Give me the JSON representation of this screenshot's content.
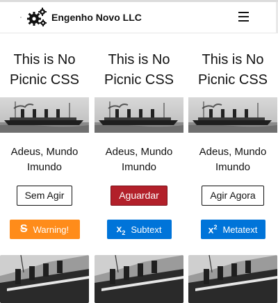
{
  "header": {
    "brand": "Engenho Novo LLC",
    "logo_icon": "gears-icon",
    "menu_icon": "hamburger-icon"
  },
  "cards": [
    {
      "title_line1": "This is No",
      "title_line2": "Picnic CSS",
      "text_line1": "Adeus, Mundo",
      "text_line2": "Imundo",
      "button": "Sem Agir",
      "action": "Warning!",
      "action_icon": "strikethrough-icon"
    },
    {
      "title_line1": "This is No",
      "title_line2": "Picnic CSS",
      "text_line1": "Adeus, Mundo",
      "text_line2": "Imundo",
      "button": "Aguardar",
      "action": "Subtext",
      "action_icon": "subscript-icon"
    },
    {
      "title_line1": "This is No",
      "title_line2": "Picnic CSS",
      "text_line1": "Adeus, Mundo",
      "text_line2": "Imundo",
      "button": "Agir Agora",
      "action": "Metatext",
      "action_icon": "superscript-icon"
    }
  ],
  "colors": {
    "warning": "#ff8c1a",
    "primary": "#0074d9",
    "danger": "#b2202a"
  }
}
